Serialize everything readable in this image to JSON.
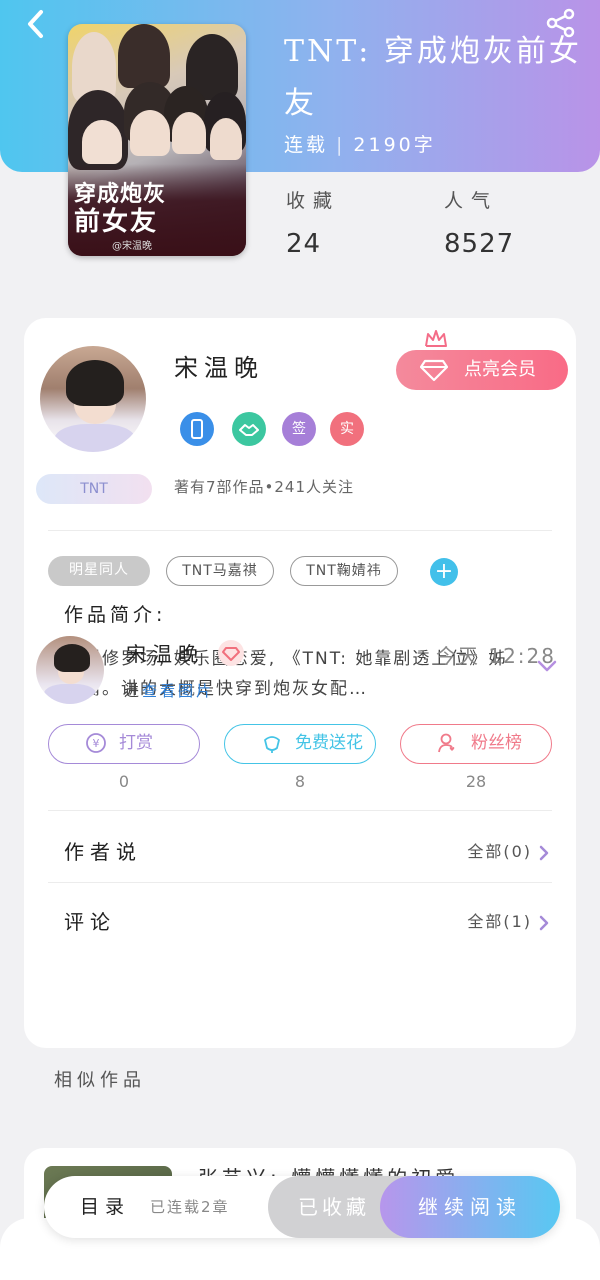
{
  "header": {
    "back_icon": "chevron-left-icon",
    "share_icon": "share-icon"
  },
  "book": {
    "cover_line1": "穿成炮灰",
    "cover_line2": "前女友",
    "cover_author": "@宋温晚",
    "title": "TNT: 穿成炮灰前女友",
    "status": "连载",
    "words": "2190字",
    "stats": [
      {
        "label": "收藏",
        "value": "24"
      },
      {
        "label": "人气",
        "value": "8527"
      }
    ]
  },
  "author": {
    "name": "宋温晚",
    "tag": "TNT",
    "vip_label": "点亮会员",
    "badges": [
      {
        "icon": "phone-badge-icon",
        "text": "",
        "color": "#3a8fe8"
      },
      {
        "icon": "handshake-badge-icon",
        "text": "",
        "color": "#3cc7a0"
      },
      {
        "icon": "sign-badge-icon",
        "text": "签",
        "color": "#a67fd8"
      },
      {
        "icon": "hot-badge-icon",
        "text": "实",
        "color": "#f1707d"
      }
    ],
    "meta": "著有7部作品•241人关注"
  },
  "tags": [
    "明星同人",
    "TNT马嘉祺",
    "TNT鞠婧祎"
  ],
  "intro": {
    "title": "作品简介:",
    "text": "大型修罗场, 娱乐圈恋爱, 《TNT: 她靠剧透上位》姊妹篇。讲的大概是快穿到炮灰女配…"
  },
  "actions": [
    {
      "label": "打赏",
      "count": "0",
      "color": "#a58ad8",
      "icon": "yen-coin-icon"
    },
    {
      "label": "免费送花",
      "count": "8",
      "color": "#44c4e6",
      "icon": "flower-icon"
    },
    {
      "label": "粉丝榜",
      "count": "28",
      "color": "#f07a8a",
      "icon": "fan-user-icon"
    }
  ],
  "author_says": {
    "title": "作者说",
    "link": "全部(0)"
  },
  "comments": {
    "title": "评论",
    "link": "全部(1)",
    "items": [
      {
        "name": "宋温晚",
        "time": "今天 12:28",
        "prefix": "进",
        "link_text": "查看图片"
      }
    ]
  },
  "similar": {
    "label": "相似作品",
    "first_title": "张艺兴: 懵懵懂懂的初爱"
  },
  "bottom_bar": {
    "toc": "目录",
    "toc_sub": "已连载2章",
    "fav": "已收藏",
    "read": "继续阅读"
  }
}
